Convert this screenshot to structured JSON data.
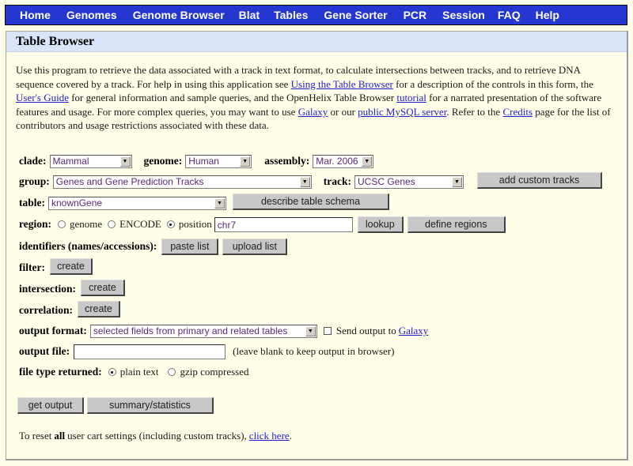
{
  "nav": {
    "items": [
      "Home",
      "Genomes",
      "Genome Browser",
      "Blat",
      "Tables",
      "Gene Sorter",
      "PCR",
      "Session",
      "FAQ",
      "Help"
    ]
  },
  "panel": {
    "title": "Table Browser"
  },
  "intro": {
    "t1": "Use this program to retrieve the data associated with a track in text format, to calculate intersections between tracks, and to retrieve DNA sequence covered by a track. For help in using this application see ",
    "link1": "Using the Table Browser",
    "t2": " for a description of the controls in this form, the ",
    "link2": "User's Guide",
    "t3": " for general information and sample queries, and the OpenHelix Table Browser ",
    "link3": "tutorial",
    "t4": " for a narrated presentation of the software features and usage. For more complex queries, you may want to use ",
    "link4": "Galaxy",
    "t5": " or our ",
    "link5": "public MySQL server",
    "t6": ". Refer to the ",
    "link6": "Credits",
    "t7": " page for the list of contributors and usage restrictions associated with these data."
  },
  "form": {
    "clade": {
      "label": "clade:",
      "value": "Mammal"
    },
    "genome": {
      "label": "genome:",
      "value": "Human"
    },
    "assembly": {
      "label": "assembly:",
      "value": "Mar. 2006"
    },
    "group": {
      "label": "group:",
      "value": "Genes and Gene Prediction Tracks"
    },
    "track": {
      "label": "track:",
      "value": "UCSC Genes"
    },
    "add_custom_tracks": "add custom tracks",
    "table": {
      "label": "table:",
      "value": "knownGene"
    },
    "describe_schema": "describe table schema",
    "region": {
      "label": "region:",
      "options": [
        "genome",
        "ENCODE",
        "position"
      ],
      "selected": "position",
      "position_value": "chr7",
      "lookup": "lookup",
      "define_regions": "define regions"
    },
    "identifiers": {
      "label": "identifiers (names/accessions):",
      "paste": "paste list",
      "upload": "upload list"
    },
    "filter": {
      "label": "filter:",
      "button": "create"
    },
    "intersection": {
      "label": "intersection:",
      "button": "create"
    },
    "correlation": {
      "label": "correlation:",
      "button": "create"
    },
    "output_format": {
      "label": "output format:",
      "value": "selected fields from primary and related tables",
      "send_output_checked": false,
      "send_output_text": "Send output to ",
      "send_output_link": "Galaxy"
    },
    "output_file": {
      "label": "output file:",
      "value": "",
      "hint": "(leave blank to keep output in browser)"
    },
    "file_type": {
      "label": "file type returned:",
      "options": [
        "plain text",
        "gzip compressed"
      ],
      "selected": "plain text"
    },
    "get_output": "get output",
    "summary": "summary/statistics"
  },
  "footer": {
    "t1": "To reset ",
    "bold": "all",
    "t2": " user cart settings (including custom tracks), ",
    "link": "click here",
    "t3": "."
  }
}
